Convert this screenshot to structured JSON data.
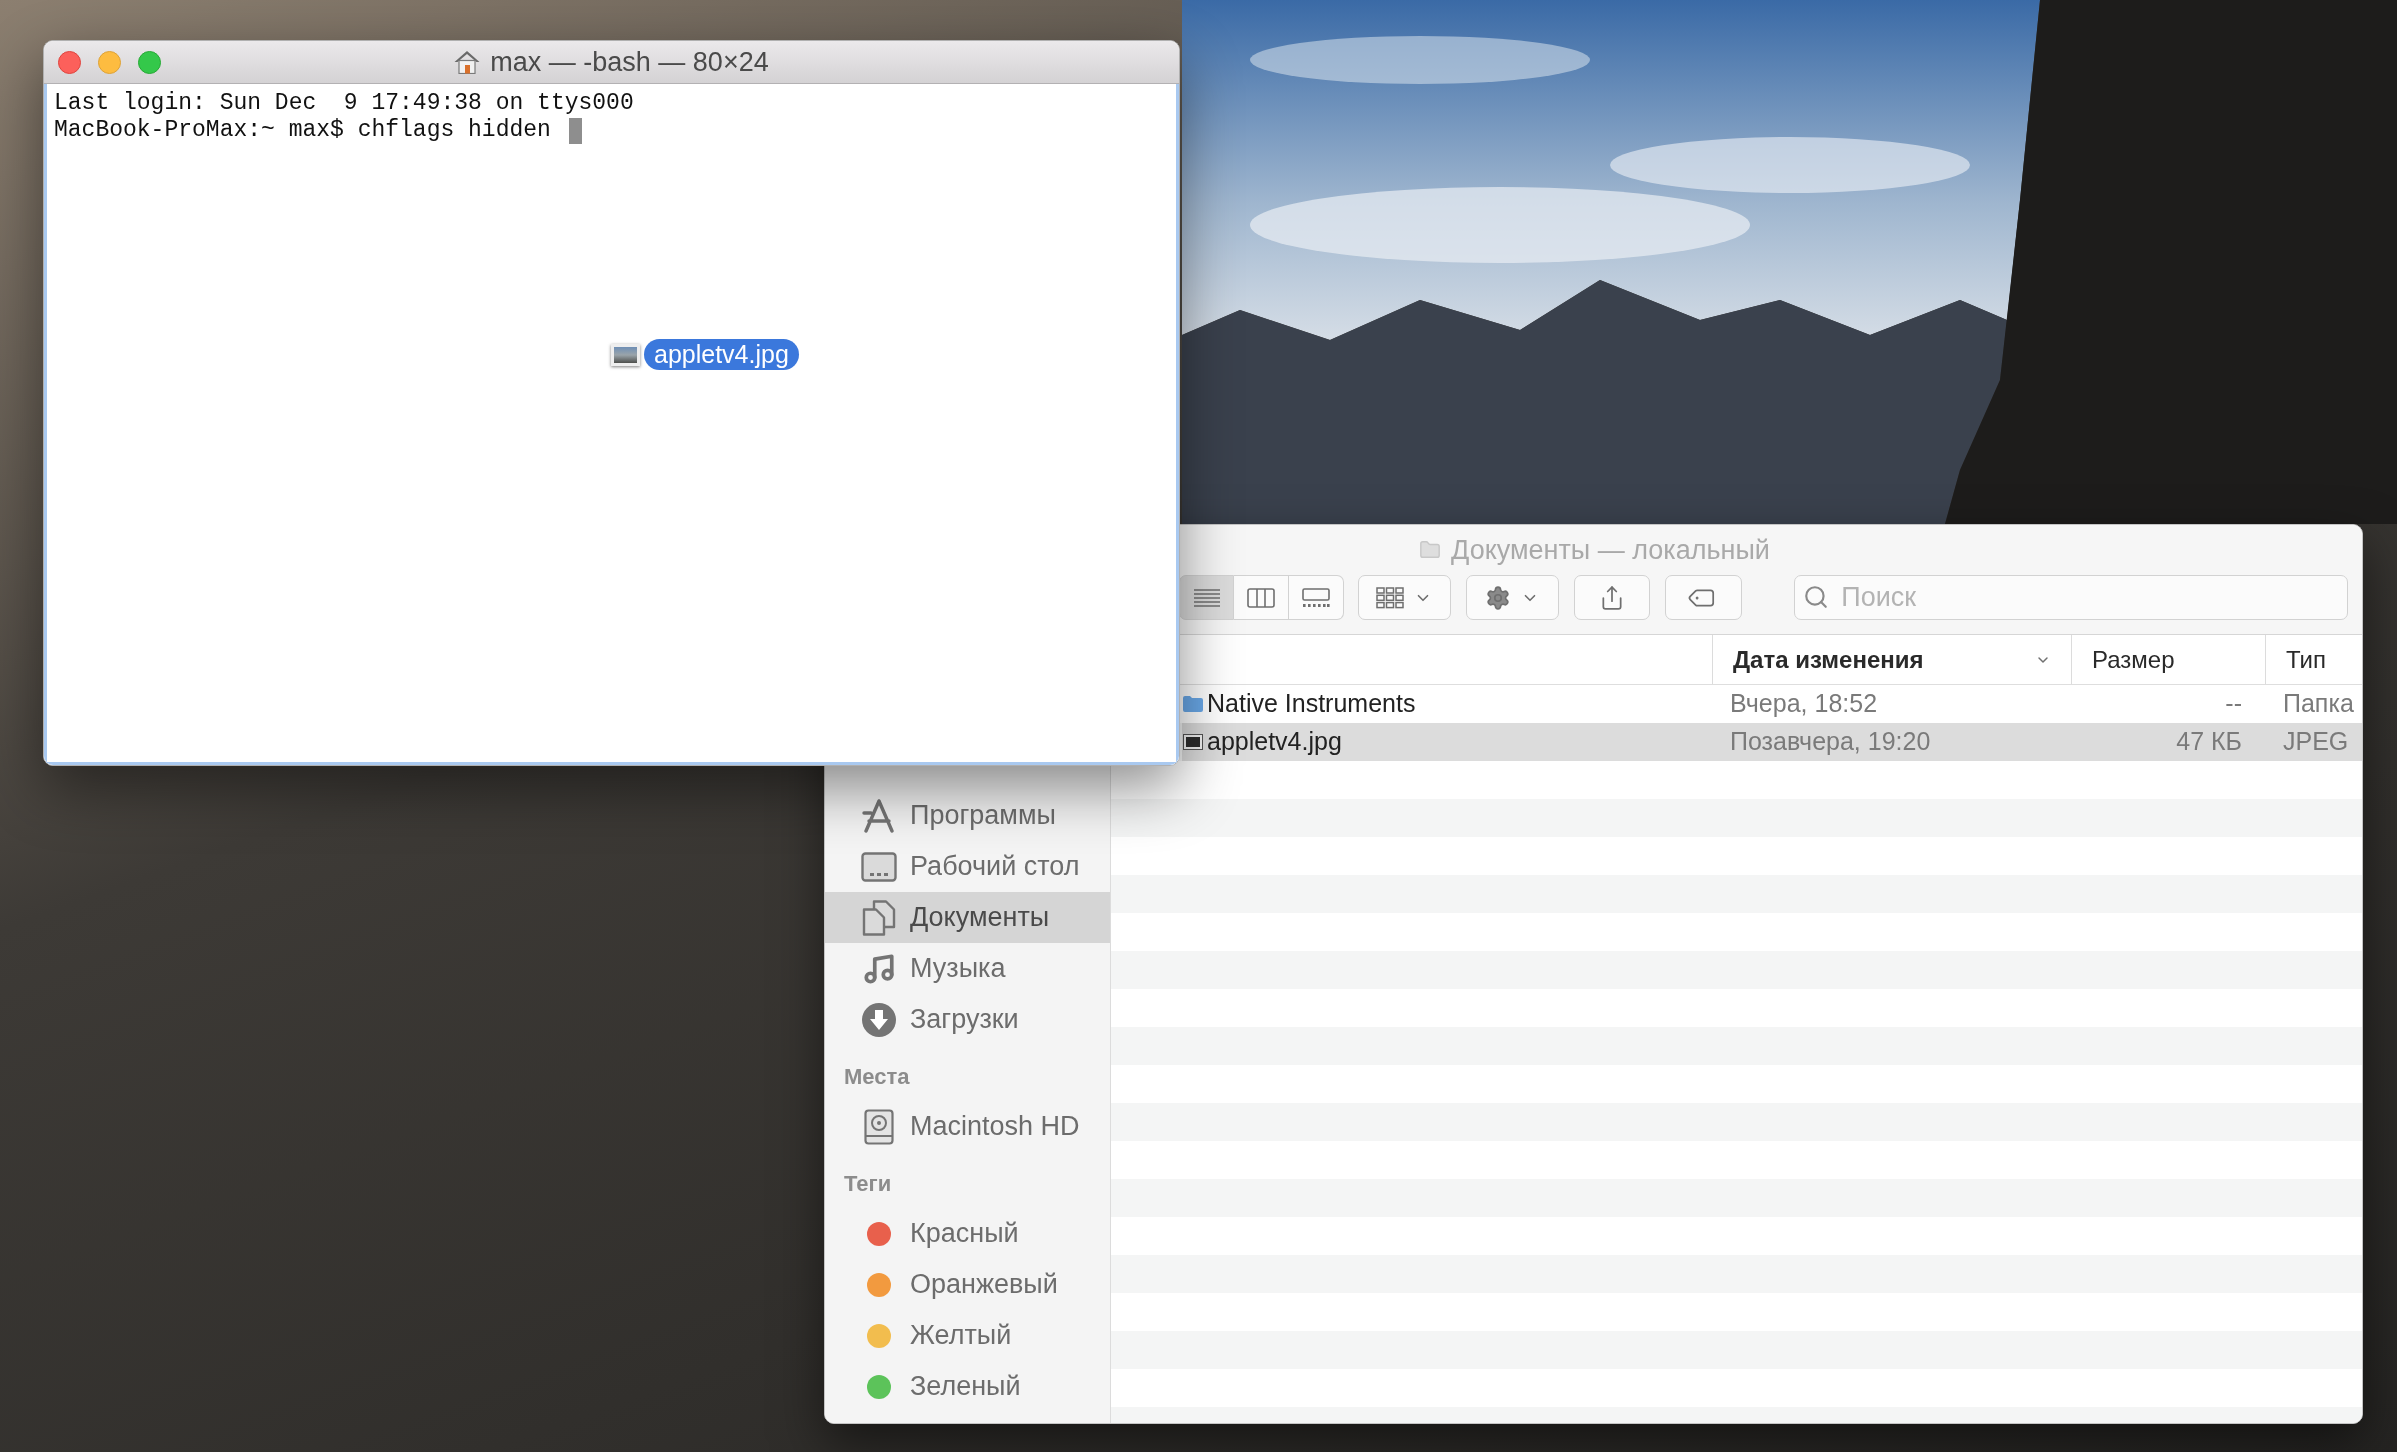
{
  "terminal": {
    "title": "max — -bash — 80×24",
    "lines": [
      "Last login: Sun Dec  9 17:49:38 on ttys000",
      "MacBook-ProMax:~ max$ chflags hidden"
    ]
  },
  "drag_item": {
    "label": "appletv4.jpg"
  },
  "finder": {
    "title": "Документы — локальный",
    "toolbar": {
      "view_modes": [
        {
          "kind": "list",
          "selected": true
        },
        {
          "kind": "columns",
          "selected": false
        },
        {
          "kind": "gallery",
          "selected": false
        }
      ],
      "search": {
        "placeholder": "Поиск"
      }
    },
    "sidebar": {
      "sections": [
        {
          "items": [
            {
              "kind": "apps",
              "label": "Программы",
              "selected": false
            },
            {
              "kind": "desktop",
              "label": "Рабочий стол",
              "selected": false
            },
            {
              "kind": "documents",
              "label": "Документы",
              "selected": true
            },
            {
              "kind": "music",
              "label": "Музыка",
              "selected": false
            },
            {
              "kind": "downloads",
              "label": "Загрузки",
              "selected": false
            }
          ]
        },
        {
          "header": "Места",
          "items": [
            {
              "kind": "disk",
              "label": "Macintosh HD",
              "selected": false
            }
          ]
        },
        {
          "header": "Теги",
          "items": [
            {
              "kind": "tag",
              "label": "Красный",
              "color": "#e8604c",
              "selected": false
            },
            {
              "kind": "tag",
              "label": "Оранжевый",
              "color": "#f29a3f",
              "selected": false
            },
            {
              "kind": "tag",
              "label": "Желтый",
              "color": "#f2bd4e",
              "selected": false
            },
            {
              "kind": "tag",
              "label": "Зеленый",
              "color": "#5cc35a",
              "selected": false
            }
          ]
        }
      ]
    },
    "columns": [
      {
        "label": "Дата изменения",
        "sorted": true
      },
      {
        "label": "Размер",
        "sorted": false
      },
      {
        "label": "Тип",
        "sorted": false
      }
    ],
    "rows": [
      {
        "kind": "folder",
        "name": "Native Instruments",
        "date": "Вчера, 18:52",
        "size": "--",
        "type": "Папка",
        "selected": false
      },
      {
        "kind": "image",
        "name": "appletv4.jpg",
        "date": "Позавчера, 19:20",
        "size": "47 КБ",
        "type": "JPEG",
        "selected": true
      }
    ]
  }
}
